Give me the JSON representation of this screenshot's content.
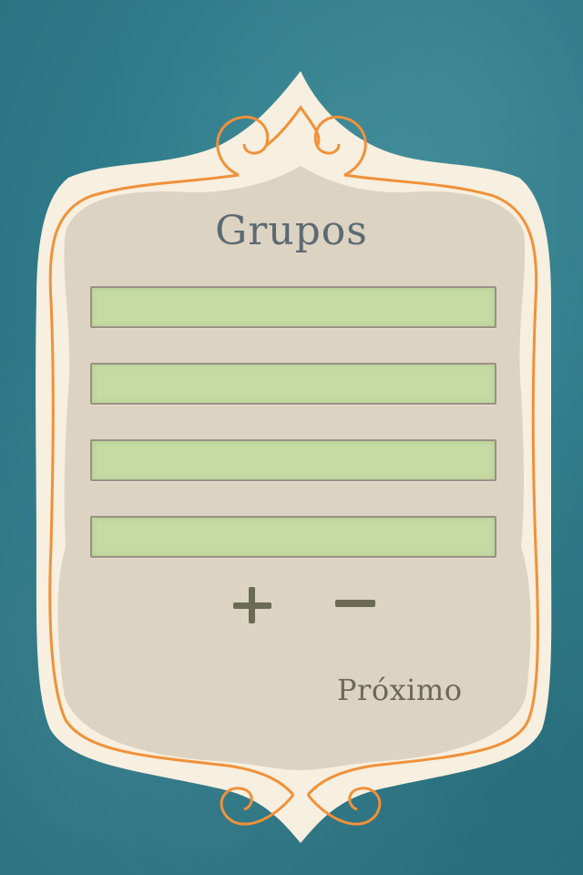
{
  "screen": {
    "title": "Grupos",
    "next_label": "Próximo",
    "add_group_icon": "plus-icon",
    "remove_group_icon": "minus-icon"
  },
  "groups": [
    {
      "value": ""
    },
    {
      "value": ""
    },
    {
      "value": ""
    },
    {
      "value": ""
    }
  ],
  "colors": {
    "background": "#2f7b8a",
    "card_outer": "#f7efdf",
    "card_inner": "#ddd3c2",
    "ornament": "#f0913a",
    "field_fill": "#c5dba3",
    "text": "#5c6a72"
  }
}
